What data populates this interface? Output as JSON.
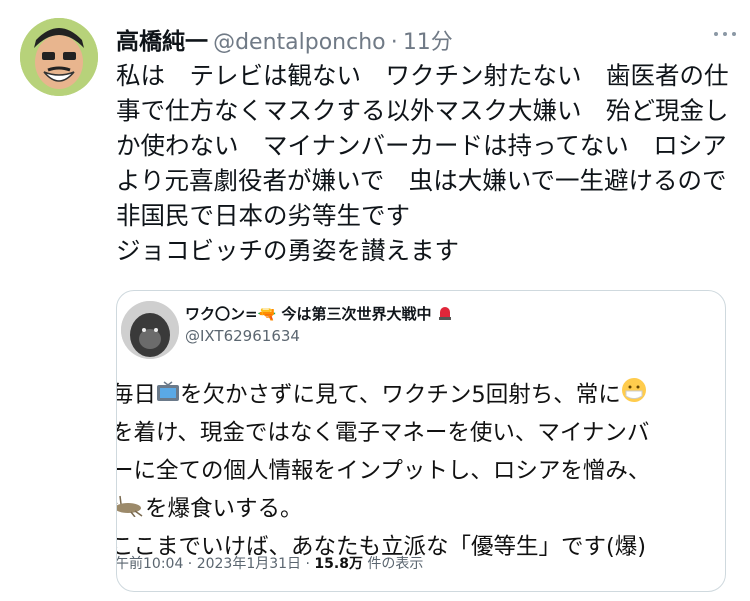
{
  "tweet": {
    "author_name": "高橋純一",
    "handle": "@dentalponcho",
    "separator": "·",
    "time": "11分",
    "text": "私は　テレビは観ない　ワクチン射たない　歯医者の仕事で仕方なくマスクする以外マスク大嫌い　殆ど現金しか使わない　マイナンバーカードは持ってない　ロシアより元喜劇役者が嫌いで　虫は大嫌いで一生避けるので非国民で日本の劣等生です\nジョコビッチの勇姿を讃えます"
  },
  "quoted": {
    "author_name": "ワク〇ン=🔫 今は第三次世界大戦中",
    "handle": "@IXT62961634",
    "lines": [
      {
        "pre": "毎日",
        "post": "を欠かさずに見て、ワクチン5回射ち、常に"
      },
      {
        "text": "を着け、現金ではなく電子マネーを使い、マイナンバ"
      },
      {
        "text": "ーに全ての個人情報をインプットし、ロシアを憎み、"
      },
      {
        "post": "を爆食いする。"
      },
      {
        "text": "ここまでいけば、あなたも立派な「優等生」です(爆)"
      }
    ],
    "meta": {
      "datetime": "午前10:04 · 2023年1月31日 · ",
      "views": "15.8万",
      "views_label": " 件の表示"
    }
  },
  "icons": {
    "avatar": "cartoon-dentist-avatar",
    "quoted_avatar": "gorilla-avatar",
    "more": "more-options-icon",
    "tv": "tv-emoji",
    "mask": "mask-face-emoji",
    "insect": "cricket-emoji",
    "alarm": "red-alarm-light-emoji"
  }
}
